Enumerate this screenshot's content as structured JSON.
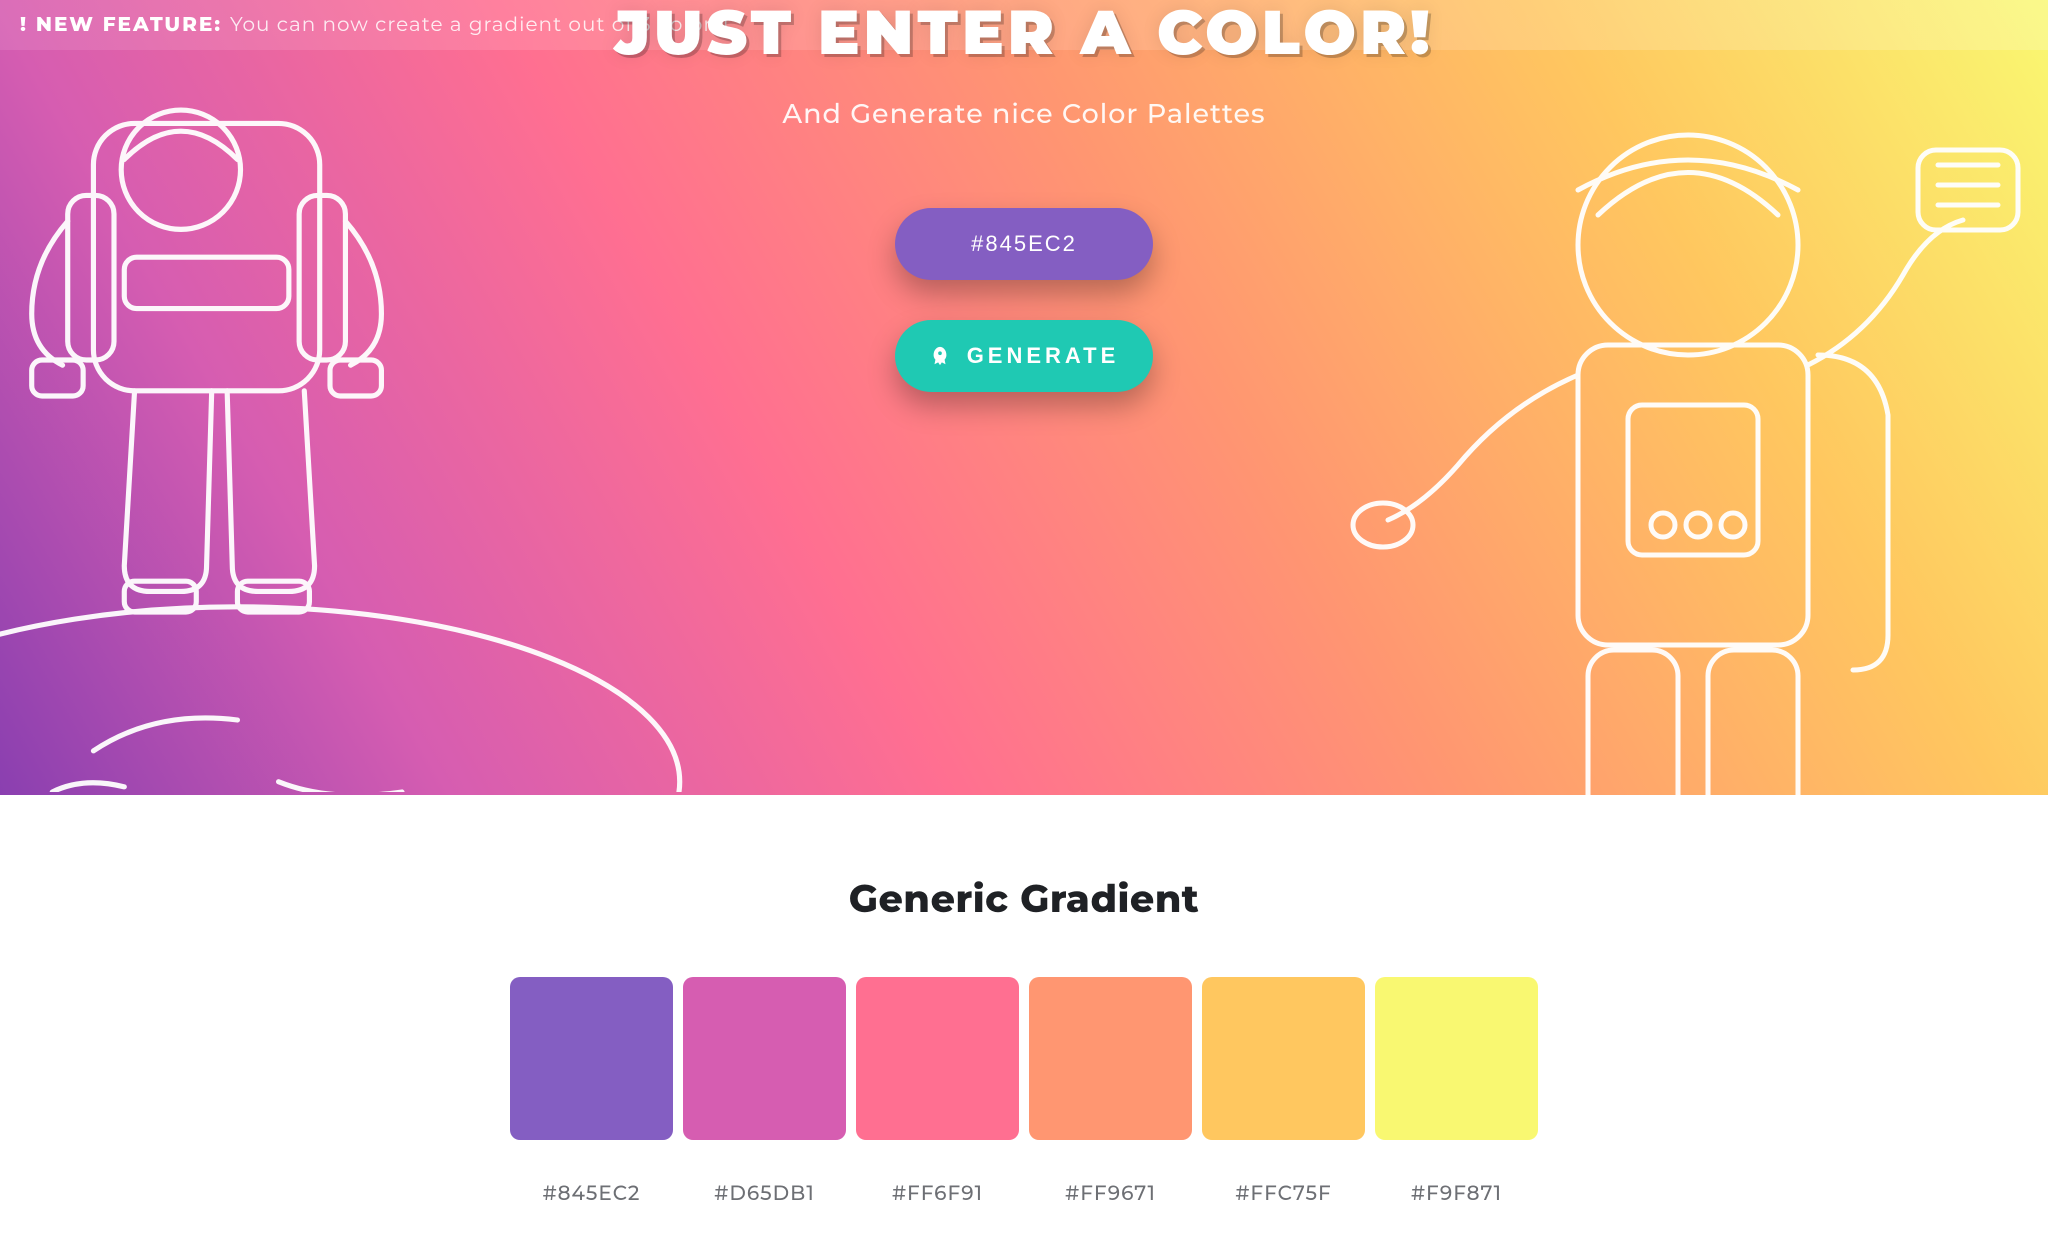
{
  "feature_strong": "! NEW FEATURE:",
  "feature_text": "You can now create a gradient out of 3 colors!",
  "hero_title": "JUST ENTER A COLOR!",
  "hero_sub": "And Generate nice Color Palettes",
  "color_input_value": "#845EC2",
  "generate_label": "GENERATE",
  "section_title": "Generic Gradient",
  "palette": {
    "0": {
      "hex": "#845EC2"
    },
    "1": {
      "hex": "#D65DB1"
    },
    "2": {
      "hex": "#FF6F91"
    },
    "3": {
      "hex": "#FF9671"
    },
    "4": {
      "hex": "#FFC75F"
    },
    "5": {
      "hex": "#F9F871"
    }
  }
}
